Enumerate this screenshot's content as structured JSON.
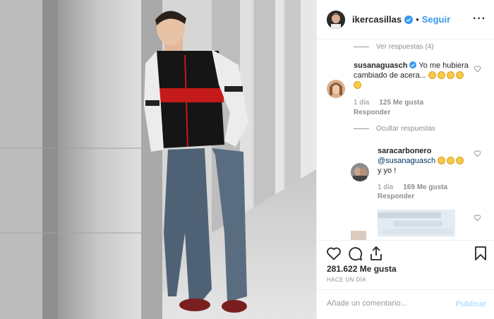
{
  "header": {
    "username": "ikercasillas",
    "separator": "•",
    "follow_label": "Seguir",
    "more_label": "···"
  },
  "comments": {
    "view_replies": "Ver respuestas (4)",
    "hide_replies": "Ocultar respuestas",
    "items": [
      {
        "username": "susanaguasch",
        "text": "Yo me hubiera cambiado de acera...",
        "time": "1 día",
        "likes": "125 Me gusta",
        "reply": "Responder"
      },
      {
        "username": "saracarbonero",
        "mention": "@susanaguasch",
        "text": "y yo !",
        "time": "1 día",
        "likes": "169 Me gusta",
        "reply": "Responder"
      }
    ]
  },
  "footer": {
    "likes": "281.622 Me gusta",
    "time_ago": "HACE UN DÍA",
    "comment_placeholder": "Añade un comentario...",
    "publish_label": "Publicar"
  },
  "icons": {
    "verified": "verified-badge-icon",
    "like": "heart-icon",
    "comment": "comment-icon",
    "share": "share-icon",
    "save": "bookmark-icon"
  },
  "colors": {
    "link": "#3897f0",
    "muted": "#8e8e8e",
    "publish_disabled": "#b2dffc"
  }
}
